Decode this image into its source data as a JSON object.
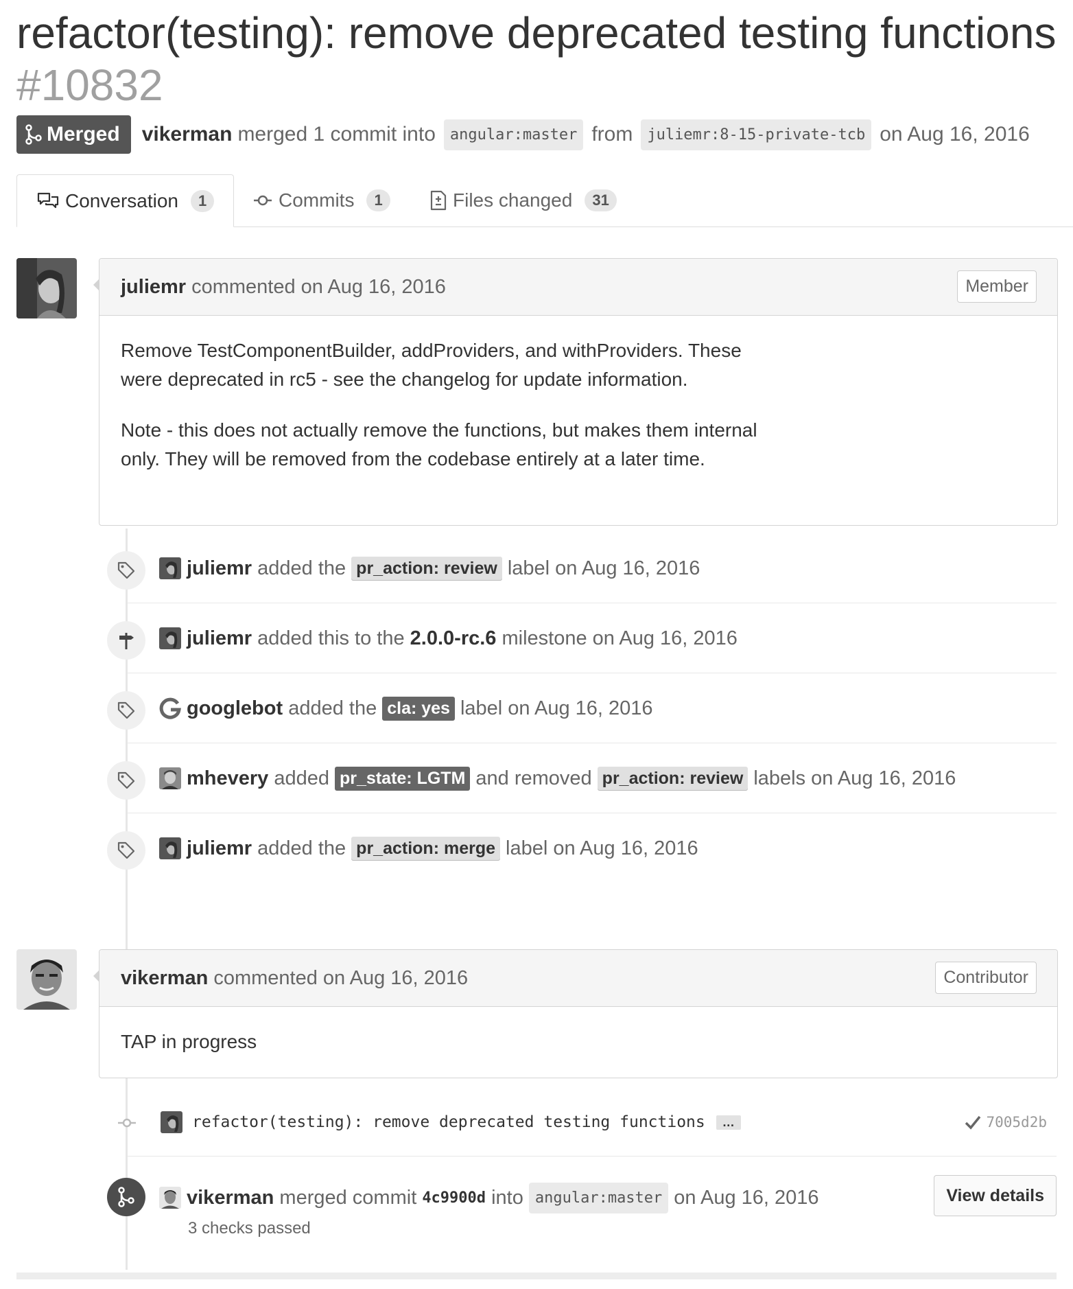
{
  "pr": {
    "title": "refactor(testing): remove deprecated testing functions",
    "number": "#10832",
    "state_label": "Merged",
    "author": "vikerman",
    "merge_text": "merged 1 commit into",
    "base_branch": "angular:master",
    "from_text": "from",
    "head_branch": "juliemr:8-15-private-tcb",
    "date_text": "on Aug 16, 2016"
  },
  "tabs": [
    {
      "label": "Conversation",
      "count": "1",
      "icon": "comment-discussion-icon"
    },
    {
      "label": "Commits",
      "count": "1",
      "icon": "git-commit-icon"
    },
    {
      "label": "Files changed",
      "count": "31",
      "icon": "file-diff-icon"
    }
  ],
  "comments": [
    {
      "author": "juliemr",
      "action": "commented on Aug 16, 2016",
      "role": "Member",
      "paragraphs": [
        "Remove TestComponentBuilder, addProviders, and withProviders. These were deprecated in rc5 - see the changelog for update information.",
        "Note - this does not actually remove the functions, but makes them internal only. They will be removed from the codebase entirely at a later time."
      ]
    },
    {
      "author": "vikerman",
      "action": "commented on Aug 16, 2016",
      "role": "Contributor",
      "paragraphs": [
        "TAP in progress"
      ]
    }
  ],
  "events": [
    {
      "actor": "juliemr",
      "pre": "added the",
      "label": "pr_action: review",
      "post": "label on Aug 16, 2016"
    },
    {
      "actor": "juliemr",
      "pre": "added this to the",
      "milestone": "2.0.0-rc.6",
      "post": "milestone on Aug 16, 2016"
    },
    {
      "actor": "googlebot",
      "pre": "added the",
      "label": "cla: yes",
      "post": "label on Aug 16, 2016"
    },
    {
      "actor": "mhevery",
      "pre": "added",
      "label": "pr_state: LGTM",
      "mid": "and removed",
      "label2": "pr_action: review",
      "post": "labels on Aug 16, 2016"
    },
    {
      "actor": "juliemr",
      "pre": "added the",
      "label": "pr_action: merge",
      "post": "label on Aug 16, 2016"
    }
  ],
  "commit": {
    "message": "refactor(testing): remove deprecated testing functions",
    "ellipsis": "…",
    "sha": "7005d2b",
    "status_icon": "check-icon"
  },
  "merge_event": {
    "actor": "vikerman",
    "text": "merged commit",
    "sha": "4c9900d",
    "into": "into",
    "branch": "angular:master",
    "date": "on Aug 16, 2016",
    "checks": "3 checks passed",
    "button": "View details"
  },
  "colors": {
    "merged_badge": "#555555",
    "label_dark": "#666666",
    "label_light": "#e0e0e0"
  }
}
